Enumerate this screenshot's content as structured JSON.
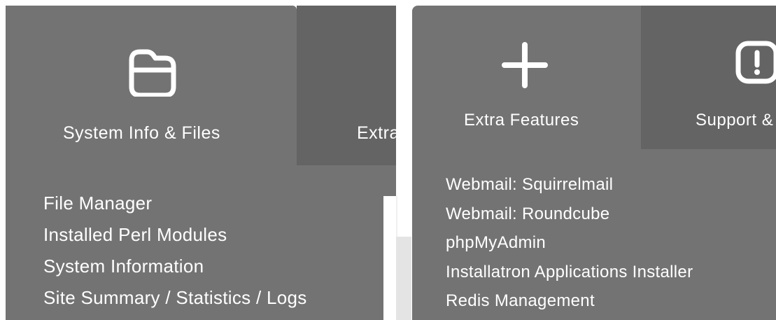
{
  "left_panel": {
    "tabs": [
      {
        "label": "System Info & Files",
        "icon": "folder-icon"
      },
      {
        "label": "Extra",
        "icon": ""
      }
    ],
    "menu_items": [
      "File Manager",
      "Installed Perl Modules",
      "System Information",
      "Site Summary / Statistics / Logs"
    ]
  },
  "right_panel": {
    "tabs": [
      {
        "label": "Extra Features",
        "icon": "plus-icon"
      },
      {
        "label": "Support &",
        "icon": "alert-icon"
      }
    ],
    "menu_items": [
      "Webmail: Squirrelmail",
      "Webmail: Roundcube",
      "phpMyAdmin",
      "Installatron Applications Installer",
      "Redis Management"
    ]
  },
  "colors": {
    "active_tab": "#737373",
    "inactive_tab": "#646464",
    "text": "#ffffff"
  }
}
